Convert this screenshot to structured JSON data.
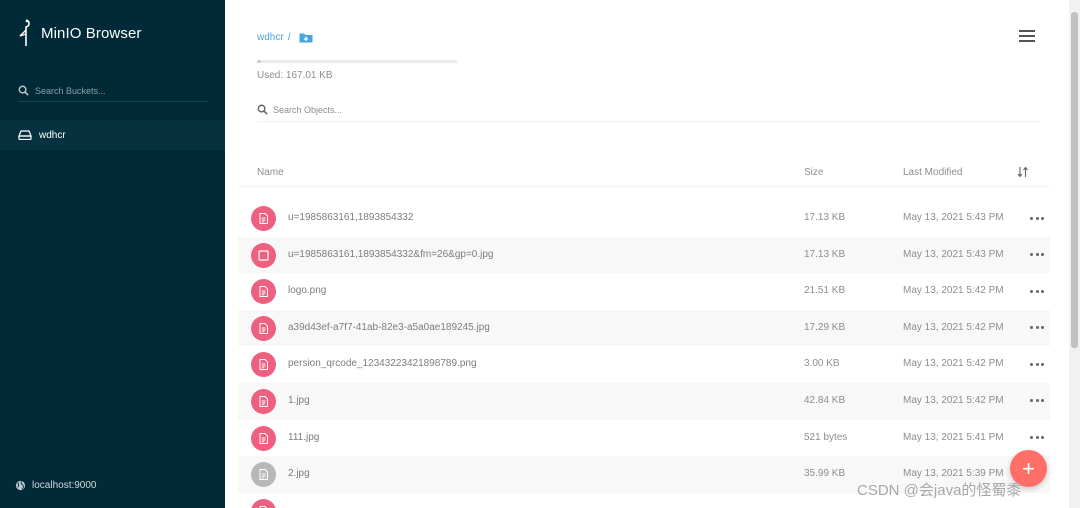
{
  "sidebar": {
    "brand": "MinIO Browser",
    "search_placeholder": "Search Buckets...",
    "buckets": [
      {
        "name": "wdhcr"
      }
    ],
    "host": "localhost:9000"
  },
  "header": {
    "bucket": "wdhcr",
    "separator": "/",
    "used_label": "Used: 167.01 KB",
    "usage_fraction": 0.02,
    "search_placeholder": "Search Objects..."
  },
  "table": {
    "columns": {
      "name": "Name",
      "size": "Size",
      "last_modified": "Last Modified"
    },
    "rows": [
      {
        "name": "u=1985863161,1893854332",
        "size": "17.13 KB",
        "modified": "May 13, 2021 5:43 PM",
        "icon": "file-icon"
      },
      {
        "name": "u=1985863161,1893854332&fm=26&gp=0.jpg",
        "size": "17.13 KB",
        "modified": "May 13, 2021 5:43 PM",
        "icon": "square-icon"
      },
      {
        "name": "logo.png",
        "size": "21.51 KB",
        "modified": "May 13, 2021 5:42 PM",
        "icon": "file-icon"
      },
      {
        "name": "a39d43ef-a7f7-41ab-82e3-a5a0ae189245.jpg",
        "size": "17.29 KB",
        "modified": "May 13, 2021 5:42 PM",
        "icon": "file-icon"
      },
      {
        "name": "persion_qrcode_12343223421898789.png",
        "size": "3.00 KB",
        "modified": "May 13, 2021 5:42 PM",
        "icon": "file-icon"
      },
      {
        "name": "1.jpg",
        "size": "42.84 KB",
        "modified": "May 13, 2021 5:42 PM",
        "icon": "file-icon"
      },
      {
        "name": "111.jpg",
        "size": "521 bytes",
        "modified": "May 13, 2021 5:41 PM",
        "icon": "file-icon"
      },
      {
        "name": "2.jpg",
        "size": "35.99 KB",
        "modified": "May 13, 2021 5:39 PM",
        "icon": "file-icon-grey"
      },
      {
        "name": "",
        "size": "",
        "modified": "",
        "icon": "file-icon"
      }
    ]
  },
  "fab_label": "+",
  "watermark": "CSDN @会java的怪蜀黍",
  "colors": {
    "sidebar": "#002a37",
    "accent": "#46a5e0",
    "file_icon": "#ee607f",
    "fab": "#ff6f68"
  }
}
